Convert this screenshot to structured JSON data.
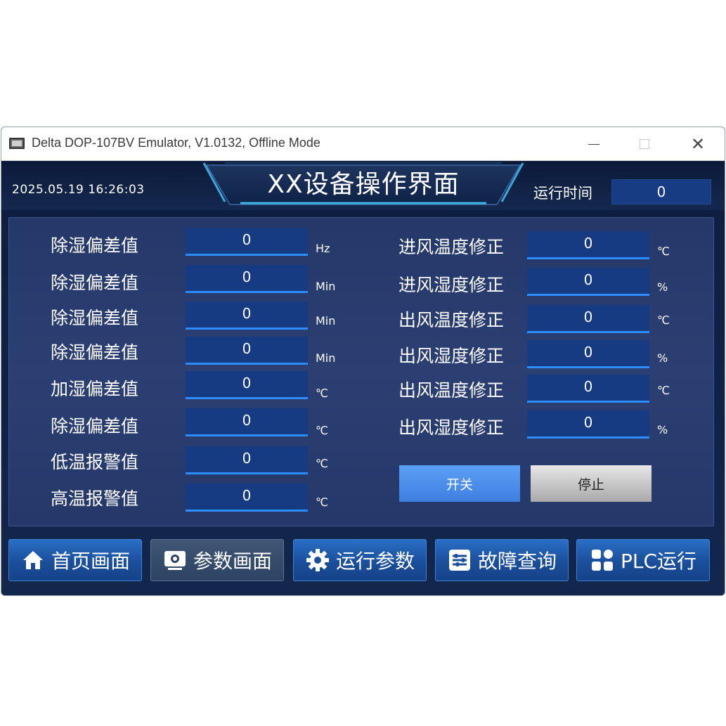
{
  "window": {
    "title": "Delta DOP-107BV Emulator, V1.0132, Offline Mode",
    "close_glyph": "✕"
  },
  "header": {
    "datetime": "2025.05.19   16:26:03",
    "title": "XX设备操作界面",
    "runtime_label": "运行时间",
    "runtime_value": "0"
  },
  "left_params": [
    {
      "label": "除湿偏差值",
      "value": "0",
      "unit": "Hz"
    },
    {
      "label": "除湿偏差值",
      "value": "0",
      "unit": "Min"
    },
    {
      "label": "除湿偏差值",
      "value": "0",
      "unit": "Min"
    },
    {
      "label": "除湿偏差值",
      "value": "0",
      "unit": "Min"
    },
    {
      "label": "加湿偏差值",
      "value": "0",
      "unit": "℃"
    },
    {
      "label": "除湿偏差值",
      "value": "0",
      "unit": "℃"
    },
    {
      "label": "低温报警值",
      "value": "0",
      "unit": "℃"
    },
    {
      "label": "高温报警值",
      "value": "0",
      "unit": "℃"
    }
  ],
  "right_params": [
    {
      "label": "进风温度修正",
      "value": "0",
      "unit": "℃"
    },
    {
      "label": "进风湿度修正",
      "value": "0",
      "unit": "%"
    },
    {
      "label": "出风温度修正",
      "value": "0",
      "unit": "℃"
    },
    {
      "label": "出风湿度修正",
      "value": "0",
      "unit": "%"
    },
    {
      "label": "出风温度修正",
      "value": "0",
      "unit": "℃"
    },
    {
      "label": "出风湿度修正",
      "value": "0",
      "unit": "%"
    }
  ],
  "buttons": {
    "onoff": "开关",
    "stop": "停止"
  },
  "nav": [
    {
      "label": "首页画面",
      "icon": "home-icon",
      "active": false
    },
    {
      "label": "参数画面",
      "icon": "monitor-icon",
      "active": true
    },
    {
      "label": "运行参数",
      "icon": "gear-icon",
      "active": false
    },
    {
      "label": "故障查询",
      "icon": "sliders-icon",
      "active": false
    },
    {
      "label": "PLC运行",
      "icon": "grid-icon",
      "active": false
    }
  ],
  "colors": {
    "screen_bg": "#0f2044",
    "field_bg": "#163b82",
    "field_underline": "#2d8cff",
    "nav_button": "#1a4f9b",
    "onoff_button": "#4a8ef0",
    "stop_button": "#c8c8c8"
  }
}
